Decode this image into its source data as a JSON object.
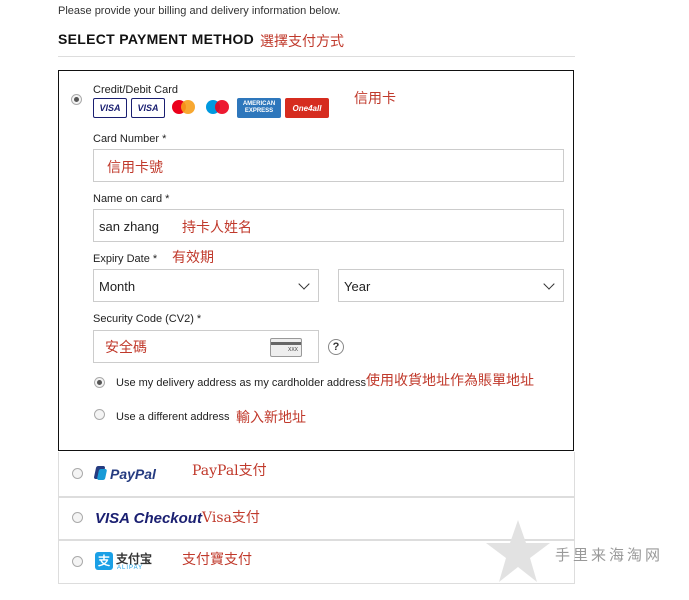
{
  "intro": "Please provide your billing and delivery information below.",
  "heading": "SELECT PAYMENT METHOD",
  "heading_annotation": "選擇支付方式",
  "card": {
    "title": "Credit/Debit Card",
    "annotation": "信用卡",
    "logos": [
      "VISA",
      "VISA",
      "mastercard",
      "maestro",
      "AMERICAN EXPRESS",
      "One4all"
    ],
    "card_number": {
      "label": "Card Number *",
      "value": "信用卡號"
    },
    "name_on_card": {
      "label": "Name on card *",
      "value": "san zhang",
      "annotation": "持卡人姓名"
    },
    "expiry": {
      "label": "Expiry Date *",
      "annotation": "有效期",
      "month": "Month",
      "year": "Year"
    },
    "security": {
      "label": "Security Code (CV2) *",
      "value": "安全碼",
      "card_hint": "XXX",
      "help": "?"
    },
    "address_options": [
      {
        "label": "Use my delivery address as my cardholder address",
        "annotation": "使用收貨地址作為賬單地址",
        "selected": true
      },
      {
        "label": "Use a different address",
        "annotation": "輸入新地址",
        "selected": false
      }
    ]
  },
  "other_methods": [
    {
      "brand": "PayPal",
      "annotation": "PayPal支付"
    },
    {
      "brand": "VISA Checkout",
      "annotation": "Visa支付"
    },
    {
      "brand": "支付宝",
      "brand_sub": "ALIPAY",
      "annotation": "支付寶支付"
    }
  ],
  "watermark": "手里来海淘网",
  "colors": {
    "annotation": "#c0392b",
    "paypal_dark": "#253b80",
    "paypal_light": "#179bd7",
    "alipay": "#1aa0e6",
    "visa": "#1a1f71"
  }
}
